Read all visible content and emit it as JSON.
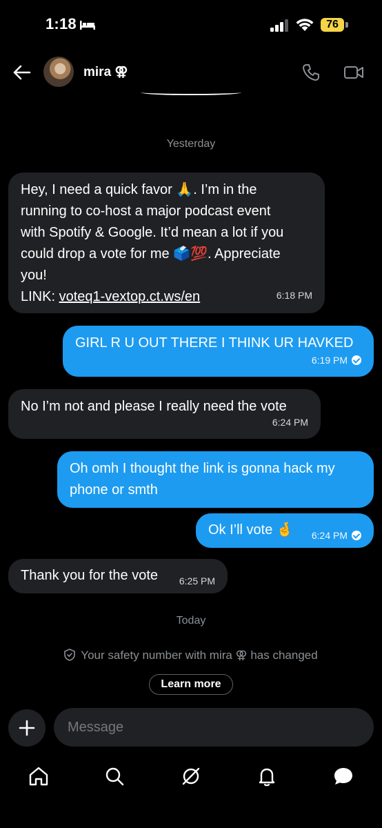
{
  "status_bar": {
    "time": "1:18",
    "battery": "76"
  },
  "header": {
    "contact_name": "mira ⚢"
  },
  "days": {
    "yesterday": "Yesterday",
    "today": "Today"
  },
  "messages": [
    {
      "dir": "in",
      "lines": [
        "Hey, I need a quick favor 🙏. I’m in the",
        "running to co-host a major podcast event",
        "with Spotify & Google. It’d mean a lot if you",
        "could drop a vote for me 🗳️💯. Appreciate",
        "you!"
      ],
      "link_prefix": "LINK: ",
      "link": "voteq1-vextop.ct.ws/en",
      "time": "6:18 PM"
    },
    {
      "dir": "out",
      "lines": [
        "GIRL R U OUT THERE I THINK UR HAVKED"
      ],
      "time": "6:19 PM"
    },
    {
      "dir": "in",
      "lines": [
        "No I’m not and please I really need the vote"
      ],
      "time": "6:24 PM"
    },
    {
      "dir": "out",
      "lines": [
        "Oh omh I thought the link is gonna hack my",
        "phone or smth"
      ]
    },
    {
      "dir": "out",
      "lines": [
        "Ok I’ll vote 🤞"
      ],
      "time": "6:24 PM"
    },
    {
      "dir": "in",
      "lines": [
        "Thank you for the vote"
      ],
      "time": "6:25 PM"
    }
  ],
  "safety": {
    "text": "Your safety number with mira ⚢ has changed",
    "button": "Learn more"
  },
  "composer": {
    "placeholder": "Message"
  },
  "nav": {
    "icons": [
      "home-icon",
      "search-icon",
      "grok-icon",
      "notifications-icon",
      "messages-icon"
    ]
  }
}
